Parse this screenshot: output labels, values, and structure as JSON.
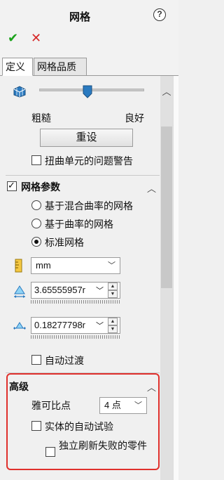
{
  "header": {
    "title": "网格",
    "help_glyph": "?",
    "ok_glyph": "✔",
    "cancel_glyph": "✕"
  },
  "tabs": [
    {
      "label": "定义",
      "active": true
    },
    {
      "label": "网格品质",
      "active": false
    }
  ],
  "density": {
    "coarse_label": "粗糙",
    "fine_label": "良好",
    "reset_label": "重设",
    "distortion_warning_label": "扭曲单元的问题警告",
    "distortion_warning_checked": false
  },
  "mesh_params": {
    "title": "网格参数",
    "title_checked": true,
    "options": [
      {
        "label": "基于混合曲率的网格",
        "selected": false
      },
      {
        "label": "基于曲率的网格",
        "selected": false
      },
      {
        "label": "标准网格",
        "selected": true
      }
    ],
    "unit": "mm",
    "global_size": "3.65555957r",
    "tolerance": "0.18277798r",
    "auto_transition_label": "自动过渡",
    "auto_transition_checked": false
  },
  "advanced": {
    "title": "高级",
    "jacobian_label": "雅可比点",
    "jacobian_value": "4 点",
    "auto_trials_label": "实体的自动试验",
    "auto_trials_checked": false,
    "remesh_failed_label": "独立刷新失败的零件",
    "remesh_failed_checked": false
  },
  "colors": {
    "ok": "#1aa31a",
    "cancel": "#d62828",
    "highlight_box": "#e0302c"
  },
  "icons": [
    "help-icon",
    "ok-check-icon",
    "cancel-x-icon",
    "mesh-density-icon",
    "ruler-unit-icon",
    "element-size-icon",
    "tolerance-icon",
    "chevron-up-icon"
  ]
}
